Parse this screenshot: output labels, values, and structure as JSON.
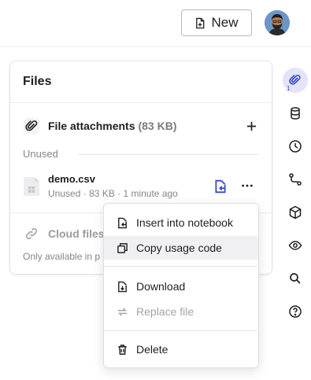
{
  "header": {
    "new_button_label": "New"
  },
  "files_panel": {
    "title": "Files",
    "attachments": {
      "title": "File attachments",
      "size": "(83 KB)"
    },
    "unused_label": "Unused",
    "file": {
      "name": "demo.csv",
      "status": "Unused",
      "size": "83 KB",
      "modified": "1 minute ago"
    },
    "cloud": {
      "label": "Cloud files",
      "sublabel": "Only available in p"
    }
  },
  "sidebar": {
    "attachments_badge": "1",
    "icons": [
      "paperclip-icon",
      "database-icon",
      "clock-icon",
      "git-icon",
      "package-icon",
      "eye-icon",
      "search-icon",
      "help-icon"
    ]
  },
  "context_menu": {
    "items": [
      {
        "label": "Insert into notebook",
        "icon": "insert-icon"
      },
      {
        "label": "Copy usage code",
        "icon": "copy-icon"
      },
      {
        "label": "Download",
        "icon": "download-icon"
      },
      {
        "label": "Replace file",
        "icon": "replace-icon"
      },
      {
        "label": "Delete",
        "icon": "trash-icon"
      }
    ]
  },
  "colors": {
    "accent": "#3b48c4",
    "active_bg": "#e3e4f7",
    "muted": "#85858c"
  }
}
